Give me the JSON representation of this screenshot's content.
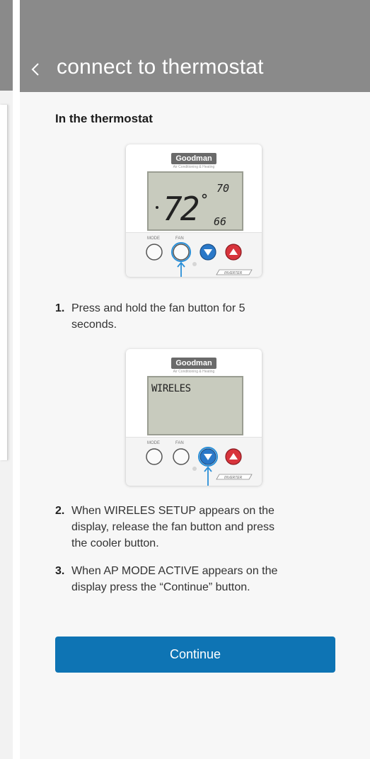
{
  "header": {
    "title": "connect to thermostat",
    "back_icon": "chevron-left-icon"
  },
  "section": {
    "title": "In the thermostat"
  },
  "thermostat1": {
    "brand": "Goodman",
    "brand_sub": "Air Conditioning & Heating",
    "temp_main": "72",
    "temp_set_high": "70",
    "temp_set_low": "66",
    "btn_mode": "MODE",
    "btn_fan": "FAN",
    "badge": "INVERTER"
  },
  "thermostat2": {
    "brand": "Goodman",
    "brand_sub": "Air Conditioning & Heating",
    "lcd_text": "WIRELES",
    "btn_mode": "MODE",
    "btn_fan": "FAN",
    "badge": "INVERTER"
  },
  "steps": [
    {
      "num": "1.",
      "line1": "Press and hold the fan button for 5",
      "line2": "seconds."
    },
    {
      "num": "2.",
      "line1": "When WIRELES SETUP appears on the",
      "line2": "display, release the fan button and press",
      "line3": "the cooler button."
    },
    {
      "num": "3.",
      "line1": "When AP MODE ACTIVE appears on the",
      "line2": "display press the “Continue”  button."
    }
  ],
  "continue_label": "Continue",
  "colors": {
    "header": "#8a8a8a",
    "accent": "#0e74b4",
    "cool": "#2a78c8",
    "heat": "#d8343c"
  }
}
